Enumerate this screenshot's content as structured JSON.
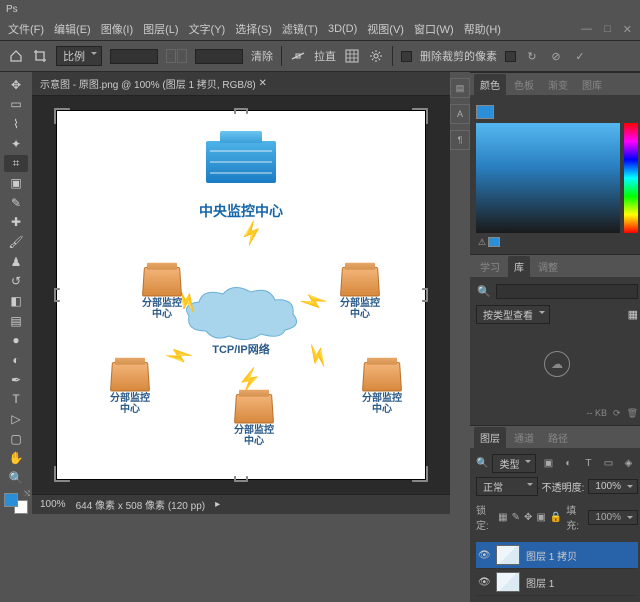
{
  "titlebar": {
    "app": "Ps"
  },
  "menu": [
    "文件(F)",
    "编辑(E)",
    "图像(I)",
    "图层(L)",
    "文字(Y)",
    "选择(S)",
    "滤镜(T)",
    "3D(D)",
    "视图(V)",
    "窗口(W)",
    "帮助(H)"
  ],
  "winctrl": {
    "min": "—",
    "max": "□",
    "close": "✕"
  },
  "options": {
    "ratio_label": "比例",
    "clear": "清除",
    "straighten": "拉直",
    "delete_pixels": "删除裁剪的像素"
  },
  "doc": {
    "title": "示意图 - 原图.png @ 100% (图层 1 拷贝, RGB/8)"
  },
  "artwork": {
    "center": "中央监控中心",
    "cloud": "TCP/IP网络",
    "node": "分部监控\n中心"
  },
  "status": {
    "zoom": "100%",
    "dims": "644 像素 x 508 像素 (120 pp)"
  },
  "panels": {
    "color_tabs": [
      "颜色",
      "色板",
      "渐变",
      "图库"
    ],
    "lib_tabs": [
      "学习",
      "库",
      "调整"
    ],
    "lib_filter": "按类型查看",
    "lib_size": "-- KB",
    "layers_tabs": [
      "图层",
      "通道",
      "路径"
    ],
    "kind": "类型",
    "blend": "正常",
    "opacity_label": "不透明度:",
    "opacity_val": "100%",
    "fill_label": "填充:",
    "fill_val": "100%",
    "lock": "锁定:",
    "layers": [
      {
        "name": "图层 1 拷贝",
        "sel": true
      },
      {
        "name": "图层 1",
        "sel": false
      }
    ]
  }
}
